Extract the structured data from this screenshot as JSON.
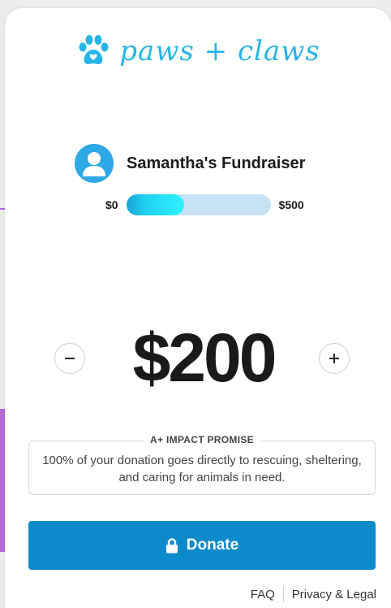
{
  "brand": {
    "logo_text": "paws + claws",
    "logo_color": "#27b4e8"
  },
  "fundraiser": {
    "title": "Samantha's Fundraiser",
    "avatar_icon": "user-icon",
    "progress": {
      "min_label": "$0",
      "max_label": "$500",
      "fraction": 0.4
    }
  },
  "amount": {
    "value": "$200",
    "decrement_icon": "minus-icon",
    "increment_icon": "plus-icon"
  },
  "promise": {
    "title": "A+ IMPACT PROMISE",
    "text": "100% of your donation goes directly to rescuing, sheltering, and caring for animals in need."
  },
  "donate": {
    "label": "Donate",
    "icon": "lock-icon",
    "color": "#0c8bcc"
  },
  "footer": {
    "faq": "FAQ",
    "privacy": "Privacy & Legal"
  }
}
